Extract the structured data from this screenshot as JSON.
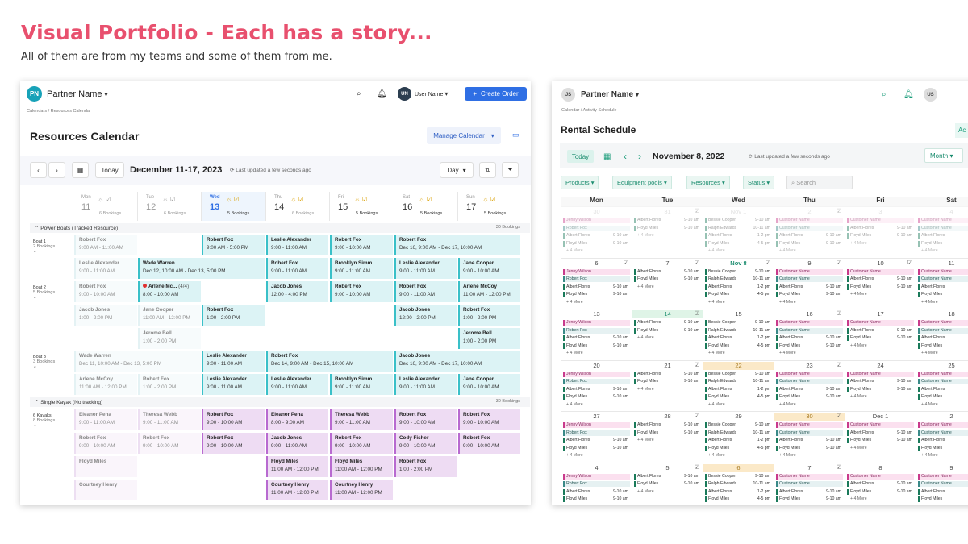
{
  "hero": {
    "title": "Visual Portfolio - Each has a story...",
    "subtitle": "All of them are from my teams and some of them from me."
  },
  "left": {
    "partner_initials": "PN",
    "partner_name": "Partner Name",
    "user_initials": "UN",
    "user_name": "User Name",
    "create_label": "Create Order",
    "breadcrumb": "Calendars / Resources Calendar",
    "title": "Resources Calendar",
    "manage_label": "Manage Calendar",
    "today_label": "Today",
    "range": "December 11-17, 2023",
    "updated": "Last updated a few seconds ago",
    "view_label": "Day",
    "days": [
      {
        "name": "Mon",
        "date": "11",
        "bookings": "6 Bookings"
      },
      {
        "name": "Tue",
        "date": "12",
        "bookings": "6 Bookings"
      },
      {
        "name": "Wed",
        "date": "13",
        "bookings": "5 Bookings"
      },
      {
        "name": "Thu",
        "date": "14",
        "bookings": "6 Bookings"
      },
      {
        "name": "Fri",
        "date": "15",
        "bookings": "5 Bookings"
      },
      {
        "name": "Sat",
        "date": "16",
        "bookings": "5 Bookings"
      },
      {
        "name": "Sun",
        "date": "17",
        "bookings": "5 Bookings"
      }
    ],
    "groups": [
      {
        "title": "Power Boats (Tracked Resource)",
        "count": "30 Bookings"
      },
      {
        "title": "Single Kayak (No tracking)",
        "count": "30 Bookings"
      }
    ],
    "resources": [
      {
        "name": "Boat 1",
        "sub": "2 Bookings"
      },
      {
        "name": "Boat 2",
        "sub": "5 Bookings"
      },
      {
        "name": "Boat 3",
        "sub": "3 Bookings"
      },
      {
        "name": "6 Kayaks",
        "sub": "8 Bookings"
      }
    ],
    "cells": [
      {
        "n": "Robert Fox",
        "t": "9:00 AM - 11:00 AM"
      },
      {
        "n": "Robert Fox",
        "t": "9:00 AM - 5:00 PM"
      },
      {
        "n": "Leslie Alexander",
        "t": "9:00 - 11:00 AM"
      },
      {
        "n": "Robert Fox",
        "t": "9:00 - 10:00 AM"
      },
      {
        "n": "Robert Fox",
        "t": "Dec 16, 9:00 AM - Dec 17, 10:00 AM"
      },
      {
        "n": "Leslie Alexander",
        "t": "9:00 - 11:00 AM"
      },
      {
        "n": "Wade Warren",
        "t": "Dec 12, 10:00 AM - Dec 13, 5:00 PM"
      },
      {
        "n": "Robert Fox",
        "t": "9:00 - 11:00 AM"
      },
      {
        "n": "Brooklyn Simm...",
        "t": "9:00 - 11:00 AM"
      },
      {
        "n": "Leslie Alexander",
        "t": "9:00 - 11:00 AM"
      },
      {
        "n": "Jane Cooper",
        "t": "9:00 - 10:00 AM"
      },
      {
        "n": "Robert Fox",
        "t": "9:00 - 10:00 AM"
      },
      {
        "n": "Arlene Mc...",
        "t": "8:00 - 10:00 AM",
        "extra": "(4/4)"
      },
      {
        "n": "Jacob Jones",
        "t": "12:00 - 4:00 PM"
      },
      {
        "n": "Robert Fox",
        "t": "9:00 - 10:00 AM"
      },
      {
        "n": "Robert Fox",
        "t": "9:00 - 11:00 AM"
      },
      {
        "n": "Arlene McCoy",
        "t": "11:00 AM - 12:00 PM"
      },
      {
        "n": "Jacob Jones",
        "t": "1:00 - 2:00 PM"
      },
      {
        "n": "Jane Cooper",
        "t": "11:00 AM - 12:00 PM"
      },
      {
        "n": "Robert Fox",
        "t": "1:00 - 2:00 PM"
      },
      {
        "n": "Jacob Jones",
        "t": "12:00 - 2:00 PM"
      },
      {
        "n": "Robert Fox",
        "t": "1:00 - 2:00 PM"
      },
      {
        "n": "Jerome Bell",
        "t": "1:00 - 2:00 PM"
      },
      {
        "n": "Jerome Bell",
        "t": "1:00 - 2:00 PM"
      },
      {
        "n": "Wade Warren",
        "t": "Dec 11, 10:00 AM - Dec 13, 5:00 PM"
      },
      {
        "n": "Leslie Alexander",
        "t": "9:00 - 11:00 AM"
      },
      {
        "n": "Robert Fox",
        "t": "Dec 14, 9:00 AM - Dec 15, 10:00 AM"
      },
      {
        "n": "Jacob Jones",
        "t": "Dec 16, 9:00 AM - Dec 17, 10:00 AM"
      },
      {
        "n": "Arlene McCoy",
        "t": "11:00 AM - 12:00 PM"
      },
      {
        "n": "Robert Fox",
        "t": "1:00 - 2:00 PM"
      },
      {
        "n": "Leslie Alexander",
        "t": "9:00 - 11:00 AM"
      },
      {
        "n": "Leslie Alexander",
        "t": "9:00 - 11:00 AM"
      },
      {
        "n": "Brooklyn Simm...",
        "t": "9:00 - 11:00 AM"
      },
      {
        "n": "Leslie Alexander",
        "t": "9:00 - 11:00 AM"
      },
      {
        "n": "Jane Cooper",
        "t": "9:00 - 10:00 AM"
      },
      {
        "n": "Eleanor Pena",
        "t": "9:00 - 11:00 AM"
      },
      {
        "n": "Theresa Webb",
        "t": "9:00 - 11:00 AM"
      },
      {
        "n": "Robert Fox",
        "t": "9:00 - 10:00 AM"
      },
      {
        "n": "Eleanor Pena",
        "t": "8:00 - 9:00 AM"
      },
      {
        "n": "Theresa Webb",
        "t": "9:00 - 11:00 AM"
      },
      {
        "n": "Robert Fox",
        "t": "9:00 - 10:00 AM"
      },
      {
        "n": "Robert Fox",
        "t": "9:00 - 10:00 AM"
      },
      {
        "n": "Robert Fox",
        "t": "9:00 - 10:00 AM"
      },
      {
        "n": "Robert Fox",
        "t": "9:00 - 10:00 AM"
      },
      {
        "n": "Robert Fox",
        "t": "9:00 - 10:00 AM"
      },
      {
        "n": "Jacob Jones",
        "t": "9:00 - 11:00 AM"
      },
      {
        "n": "Robert Fox",
        "t": "9:00 - 10:00 AM"
      },
      {
        "n": "Cody Fisher",
        "t": "9:00 - 10:00 AM"
      },
      {
        "n": "Robert Fox",
        "t": "9:00 - 10:00 AM"
      },
      {
        "n": "Floyd Miles",
        "t": ""
      },
      {
        "n": "Floyd Miles",
        "t": "11:00 AM - 12:00 PM"
      },
      {
        "n": "Floyd Miles",
        "t": "11:00 AM - 12:00 PM"
      },
      {
        "n": "Robert Fox",
        "t": "1:00 - 2:00 PM"
      },
      {
        "n": "Courtney Henry",
        "t": ""
      },
      {
        "n": "Courtney Henry",
        "t": "11:00 AM - 12:00 PM"
      },
      {
        "n": "Courtney Henry",
        "t": "11:00 AM - 12:00 PM"
      }
    ]
  },
  "right": {
    "partner_initials": "JS",
    "partner_name": "Partner Name",
    "user_initials": "US",
    "breadcrumb": "Calendar  /  Activity Schedule",
    "title": "Rental Schedule",
    "action_label": "Ac",
    "today_label": "Today",
    "date": "November 8, 2022",
    "updated": "Last updated a few seconds ago",
    "view_label": "Month",
    "filters": [
      "Products",
      "Equipment pools",
      "Resources",
      "Status"
    ],
    "search_placeholder": "Search",
    "weekdays": [
      "Mon",
      "Tue",
      "Wed",
      "Thu",
      "Fri",
      "Sat"
    ],
    "weeks": [
      [
        "30",
        "31",
        "Nov 1",
        "2",
        "3",
        "4"
      ],
      [
        "6",
        "7",
        "Nov 8",
        "9",
        "10",
        "11"
      ],
      [
        "13",
        "14",
        "15",
        "16",
        "17",
        "18"
      ],
      [
        "20",
        "21",
        "22",
        "23",
        "24",
        "25"
      ],
      [
        "27",
        "28",
        "29",
        "30",
        "Dec 1",
        "2"
      ],
      [
        "4",
        "5",
        "6",
        "7",
        "8",
        "9"
      ]
    ],
    "ev": {
      "jenny": "Jenny Wilson",
      "robert": "Robert Fox",
      "albert": "Albert Flores",
      "floyd": "Floyd Miles",
      "bessie": "Bessie Cooper",
      "ralph": "Ralph Edwards",
      "customer": "Customer Name",
      "more": "+ 4 More",
      "t1": "9-10 am",
      "t2": "10-11 am",
      "t3": "1-2 pm",
      "t4": "4-5 pm"
    }
  }
}
